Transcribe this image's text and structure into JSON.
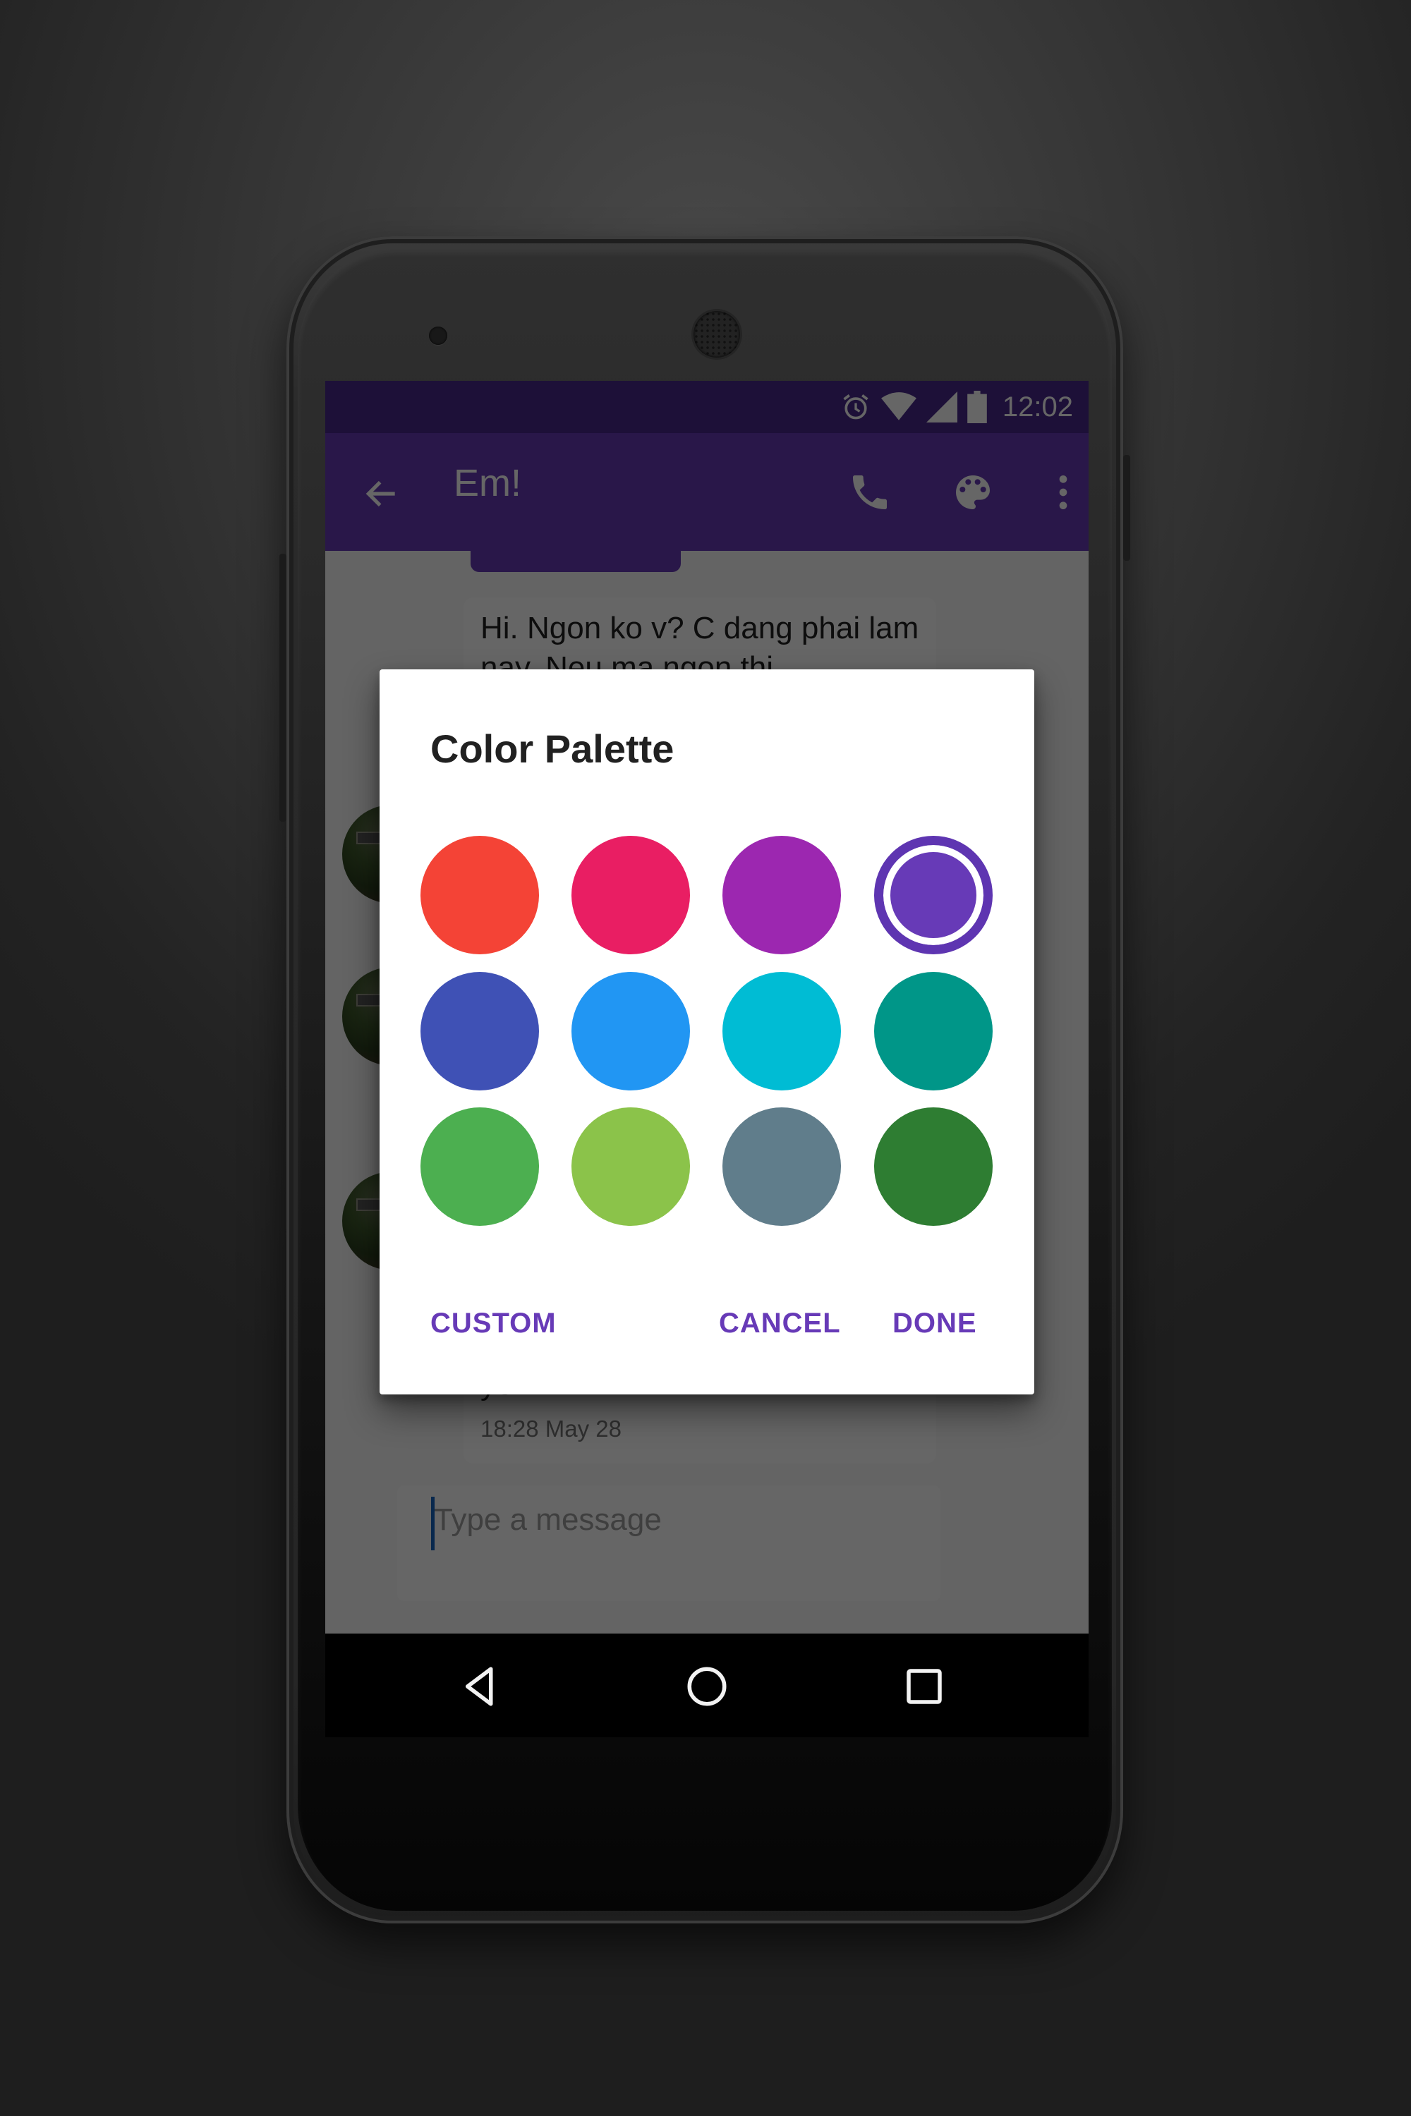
{
  "status_bar": {
    "time": "12:02",
    "icons": [
      "alarm-icon",
      "wifi-icon",
      "cell-signal-icon",
      "battery-icon"
    ]
  },
  "toolbar": {
    "title": "Em!",
    "back_icon": "arrow-back-icon",
    "actions": [
      "phone-icon",
      "palette-icon",
      "more-vert-icon"
    ]
  },
  "conversation": {
    "messages": [
      {
        "text": "Hi. Ngon ko v? C dang phai lam nay. Neu ma ngon thi",
        "partially_hidden": true
      },
      {
        "text": "yen",
        "time": "18:28 May 28"
      }
    ]
  },
  "composer": {
    "placeholder": "Type a message"
  },
  "dialog": {
    "title": "Color Palette",
    "colors": [
      {
        "name": "red",
        "hex": "#F44336"
      },
      {
        "name": "pink",
        "hex": "#E91E63"
      },
      {
        "name": "purple",
        "hex": "#9C27B0"
      },
      {
        "name": "deep-purple",
        "hex": "#673AB7",
        "selected": true
      },
      {
        "name": "indigo",
        "hex": "#3F51B5"
      },
      {
        "name": "blue",
        "hex": "#2196F3"
      },
      {
        "name": "cyan",
        "hex": "#00BCD4"
      },
      {
        "name": "teal",
        "hex": "#009688"
      },
      {
        "name": "green",
        "hex": "#4CAF50"
      },
      {
        "name": "light-green",
        "hex": "#8BC34A"
      },
      {
        "name": "blue-grey",
        "hex": "#607D8B"
      },
      {
        "name": "dark-green",
        "hex": "#2E7D32"
      }
    ],
    "buttons": {
      "custom": "CUSTOM",
      "cancel": "CANCEL",
      "done": "DONE"
    },
    "accent_color": "#673AB7"
  },
  "nav_bar": {
    "icons": [
      "back-triangle-icon",
      "home-circle-icon",
      "recents-square-icon"
    ]
  },
  "theme": {
    "primary": "#673AB7",
    "primary_dark": "#4A2A8C"
  }
}
